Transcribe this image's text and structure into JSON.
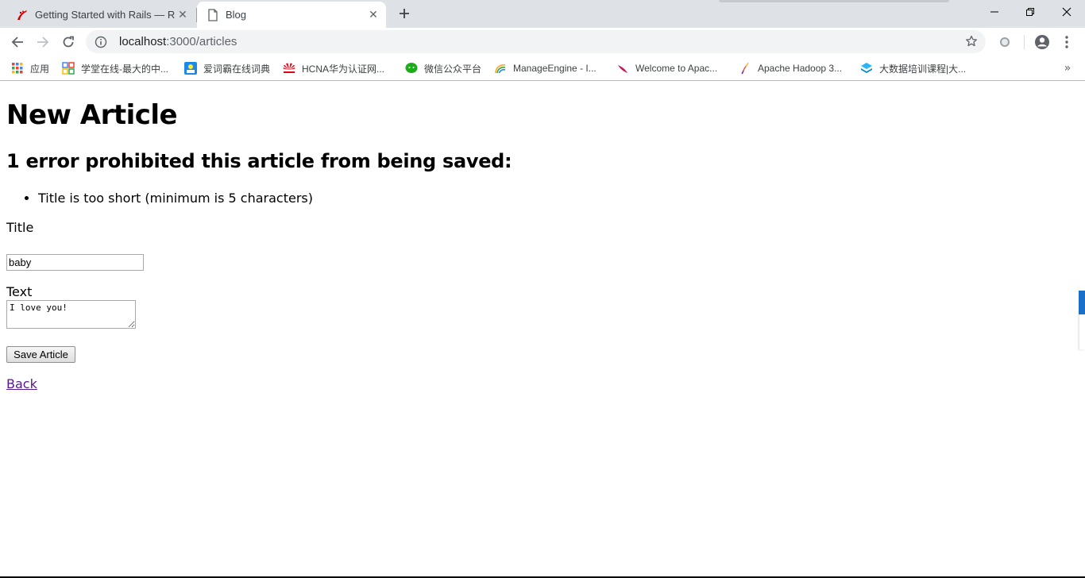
{
  "browser": {
    "tabs": [
      {
        "title": "Getting Started with Rails — R",
        "icon": "rails-icon",
        "active": false
      },
      {
        "title": "Blog",
        "icon": "document-icon",
        "active": true
      }
    ],
    "address": {
      "host": "localhost",
      "path": ":3000/articles"
    },
    "bookmarks": [
      {
        "label": "应用",
        "icon": "apps-grid-icon"
      },
      {
        "label": "学堂在线-最大的中...",
        "icon": "xuetang-icon"
      },
      {
        "label": "爱词霸在线词典",
        "icon": "iciba-icon"
      },
      {
        "label": "HCNA华为认证网...",
        "icon": "huawei-icon"
      },
      {
        "label": "微信公众平台",
        "icon": "wechat-icon"
      },
      {
        "label": "ManageEngine - I...",
        "icon": "manageengine-icon"
      },
      {
        "label": "Welcome to Apac...",
        "icon": "apache-feather-icon"
      },
      {
        "label": "Apache Hadoop 3...",
        "icon": "apache-feather-icon"
      },
      {
        "label": "大数据培训课程|大...",
        "icon": "bigdata-icon"
      }
    ],
    "bookmarks_overflow": "»"
  },
  "page": {
    "title": "New Article",
    "error_heading": "1 error prohibited this article from being saved:",
    "errors": [
      "Title is too short (minimum is 5 characters)"
    ],
    "title_label": "Title",
    "title_value": "baby",
    "text_label": "Text",
    "text_value": "I love you!",
    "save_label": "Save Article",
    "back_label": "Back"
  },
  "colors": {
    "tabstrip": "#dee1e6",
    "omnibox": "#f1f3f4",
    "visited_link": "#551a8b",
    "side_widget": "#1a6fc9"
  }
}
